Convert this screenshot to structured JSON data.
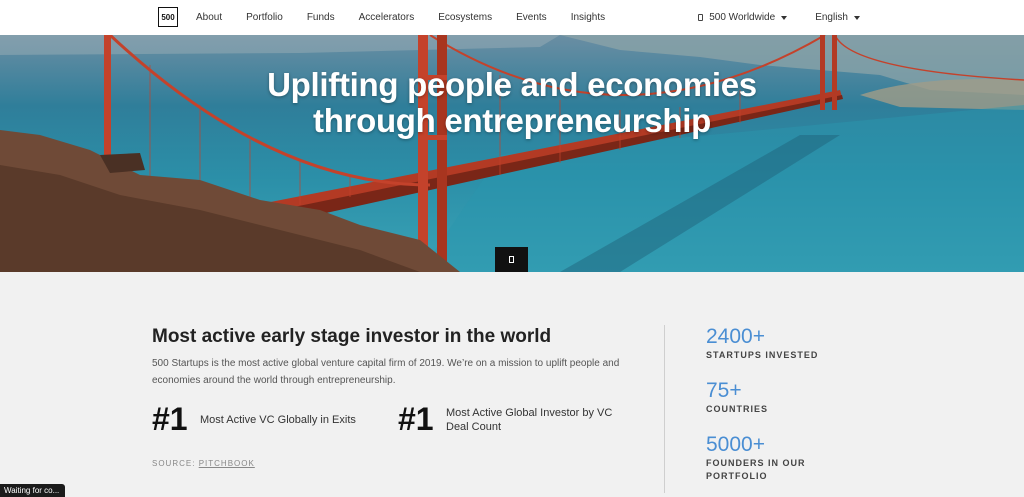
{
  "nav": {
    "logo": "500",
    "links": [
      "About",
      "Portfolio",
      "Funds",
      "Accelerators",
      "Ecosystems",
      "Events",
      "Insights"
    ],
    "region_label": "500 Worldwide",
    "language_label": "English"
  },
  "hero": {
    "title_line1": "Uplifting people and economies",
    "title_line2": "through entrepreneurship"
  },
  "intro": {
    "headline": "Most active early stage investor in the world",
    "description": "500 Startups is the most active global venture capital firm of 2019. We’re on a mission to uplift people and economies around the world through entrepreneurship."
  },
  "stats": [
    {
      "rank": "#1",
      "text_line1": "Most Active VC Globally in Exits",
      "text_line2": ""
    },
    {
      "rank": "#1",
      "text_line1": "Most Active Global Investor by VC",
      "text_line2": "Deal Count"
    }
  ],
  "source": {
    "label": "SOURCE:",
    "link": "PITCHBOOK"
  },
  "kpis": [
    {
      "value": "2400+",
      "label_line1": "STARTUPS INVESTED",
      "label_line2": ""
    },
    {
      "value": "75+",
      "label_line1": "COUNTRIES",
      "label_line2": ""
    },
    {
      "value": "5000+",
      "label_line1": "FOUNDERS IN OUR",
      "label_line2": "PORTFOLIO"
    }
  ],
  "status_bar": "Waiting for co...",
  "colors": {
    "accent": "#4a8ed3",
    "bridge": "#c4422b",
    "nav_bg": "#ffffff",
    "page_bg": "#f1f1f1"
  }
}
